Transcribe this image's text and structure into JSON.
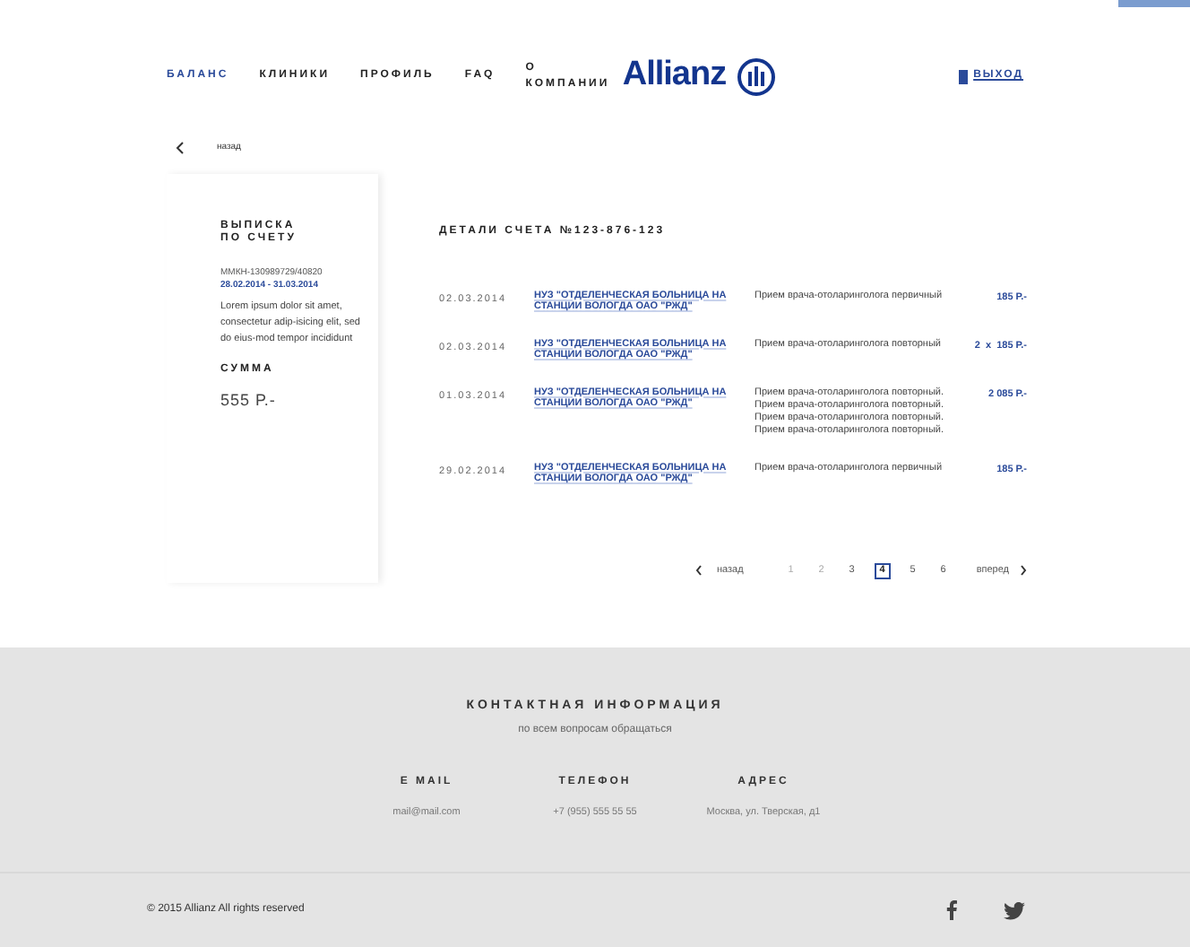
{
  "nav": [
    {
      "label": "БАЛАНС",
      "selected": true
    },
    {
      "label": "КЛИНИКИ",
      "selected": false
    },
    {
      "label": "ПРОФИЛЬ",
      "selected": false
    },
    {
      "label": "FAQ",
      "selected": false
    },
    {
      "label": "О КОМПАНИИ",
      "selected": false
    }
  ],
  "logo": "Allianz",
  "logout": "ВЫХОД",
  "back": "назад",
  "sidebar": {
    "title": "ВЫПИСКА\nПО СЧЕТУ",
    "account": "ММКН-130989729/40820",
    "period": "28.02.2014 - 31.03.2014",
    "text": "Lorem ipsum dolor sit amet, consectetur adip-isicing elit, sed do eius-mod tempor incididunt",
    "sum_label": "СУММА",
    "sum": "555 Р.-"
  },
  "details": {
    "title": "ДЕТАЛИ СЧЕТА №123-876-123",
    "rows": [
      {
        "date": "02.03.2014",
        "clinic": "НУЗ \"ОТДЕЛЕНЧЕСКАЯ БОЛЬНИЦА НА СТАНЦИИ ВОЛОГДА ОАО \"РЖД\"",
        "service": "Прием врача-отоларинголога первичный",
        "price": "185 Р.-"
      },
      {
        "date": "02.03.2014",
        "clinic": "НУЗ \"ОТДЕЛЕНЧЕСКАЯ БОЛЬНИЦА НА СТАНЦИИ ВОЛОГДА ОАО \"РЖД\"",
        "service": "Прием врача-отоларинголога повторный",
        "price": "2  x  185 Р.-"
      },
      {
        "date": "01.03.2014",
        "clinic": "НУЗ \"ОТДЕЛЕНЧЕСКАЯ БОЛЬНИЦА НА СТАНЦИИ ВОЛОГДА ОАО \"РЖД\"",
        "service": "Прием врача-отоларинголога повторный. Прием врача-отоларинголога повторный. Прием врача-отоларинголога повторный. Прием врача-отоларинголога повторный.",
        "price": "2 085 Р.-"
      },
      {
        "date": "29.02.2014",
        "clinic": "НУЗ \"ОТДЕЛЕНЧЕСКАЯ БОЛЬНИЦА НА СТАНЦИИ ВОЛОГДА ОАО \"РЖД\"",
        "service": "Прием врача-отоларинголога первичный",
        "price": "185 Р.-"
      }
    ]
  },
  "pagination": {
    "prev": "назад",
    "next": "вперед",
    "pages": [
      {
        "label": "1",
        "selected": false
      },
      {
        "label": "2",
        "selected": false
      },
      {
        "label": "3",
        "selected": false
      },
      {
        "label": "4",
        "selected": true
      },
      {
        "label": "5",
        "selected": false
      },
      {
        "label": "6",
        "selected": false
      }
    ]
  },
  "contacts": {
    "title": "КОНТАКТНАЯ ИНФОРМАЦИЯ",
    "subtitle": "по всем вопросам обращаться",
    "columns": [
      {
        "label": "E MAIL",
        "value": "mail@mail.com"
      },
      {
        "label": "ТЕЛЕФОН",
        "value": "+7 (955) 555 55 55"
      },
      {
        "label": "АДРЕС",
        "value": "Москва, ул. Тверская, д1"
      }
    ]
  },
  "copyright": "© 2015 Allianz All rights reserved"
}
